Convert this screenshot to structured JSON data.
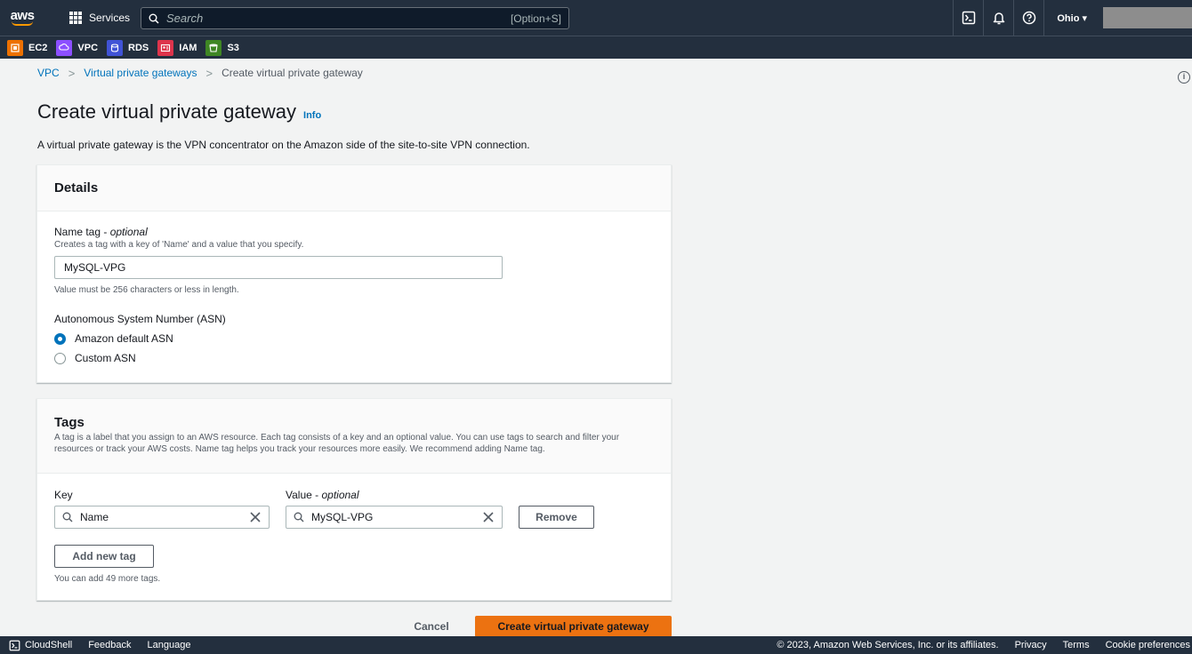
{
  "nav": {
    "logo": "aws",
    "services_label": "Services",
    "search_placeholder": "Search",
    "search_shortcut": "[Option+S]",
    "region": "Ohio ▾"
  },
  "favorites": [
    {
      "label": "EC2",
      "color": "#ed7100",
      "icon": "ec2-icon"
    },
    {
      "label": "VPC",
      "color": "#8c4fff",
      "icon": "vpc-icon"
    },
    {
      "label": "RDS",
      "color": "#4053d6",
      "icon": "rds-icon"
    },
    {
      "label": "IAM",
      "color": "#dd344c",
      "icon": "iam-icon"
    },
    {
      "label": "S3",
      "color": "#3f8624",
      "icon": "s3-icon"
    }
  ],
  "breadcrumb": {
    "items": [
      "VPC",
      "Virtual private gateways"
    ],
    "current": "Create virtual private gateway"
  },
  "header": {
    "title": "Create virtual private gateway",
    "info": "Info",
    "description": "A virtual private gateway is the VPN concentrator on the Amazon side of the site-to-site VPN connection."
  },
  "details": {
    "title": "Details",
    "name_tag_label": "Name tag - ",
    "name_tag_optional": "optional",
    "name_tag_desc": "Creates a tag with a key of 'Name' and a value that you specify.",
    "name_tag_value": "MySQL-VPG",
    "name_tag_constraint": "Value must be 256 characters or less in length.",
    "asn_label": "Autonomous System Number (ASN)",
    "asn_options": [
      {
        "label": "Amazon default ASN",
        "selected": true
      },
      {
        "label": "Custom ASN",
        "selected": false
      }
    ]
  },
  "tags": {
    "title": "Tags",
    "description": "A tag is a label that you assign to an AWS resource. Each tag consists of a key and an optional value. You can use tags to search and filter your resources or track your AWS costs. Name tag helps you track your resources more easily. We recommend adding Name tag.",
    "key_label": "Key",
    "value_label": "Value - ",
    "value_optional": "optional",
    "rows": [
      {
        "key": "Name",
        "value": "MySQL-VPG"
      }
    ],
    "remove_label": "Remove",
    "add_label": "Add new tag",
    "remaining": "You can add 49 more tags."
  },
  "actions": {
    "cancel": "Cancel",
    "submit": "Create virtual private gateway"
  },
  "footer": {
    "cloudshell": "CloudShell",
    "feedback": "Feedback",
    "language": "Language",
    "copyright": "© 2023, Amazon Web Services, Inc. or its affiliates.",
    "privacy": "Privacy",
    "terms": "Terms",
    "cookies": "Cookie preferences"
  },
  "colors": {
    "nav_bg": "#232f3e",
    "link": "#0073bb",
    "primary": "#ec7211"
  }
}
